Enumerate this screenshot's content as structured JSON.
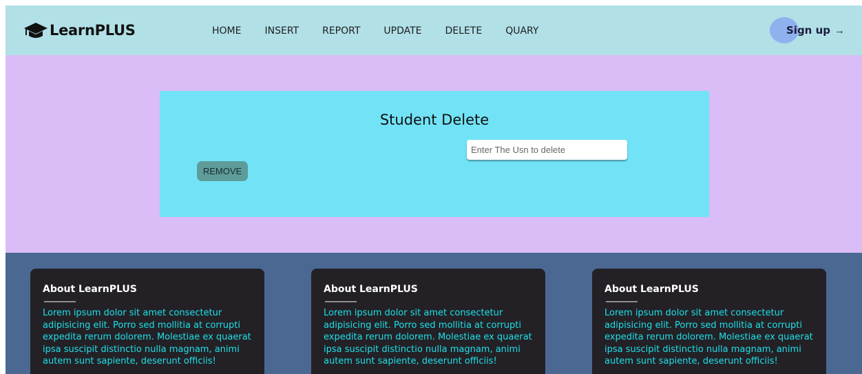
{
  "navbar": {
    "logo_icon": "graduation-cap-icon",
    "brand": "LearnPLUS",
    "links": [
      "HOME",
      "INSERT",
      "REPORT",
      "UPDATE",
      "DELETE",
      "QUARY"
    ],
    "signup_label": "Sign up",
    "signup_arrow": "→"
  },
  "main": {
    "title": "Student Delete",
    "usn_input": {
      "placeholder": "Enter The Usn to delete",
      "value": ""
    },
    "remove_label": "REMOVE"
  },
  "footer": {
    "cards": [
      {
        "title": "About LearnPLUS",
        "text": "Lorem ipsum dolor sit amet consectetur adipisicing elit. Porro sed mollitia at corrupti expedita rerum dolorem. Molestiae ex quaerat ipsa suscipit distinctio nulla magnam, animi autem sunt sapiente, deserunt officiis!"
      },
      {
        "title": "About LearnPLUS",
        "text": "Lorem ipsum dolor sit amet consectetur adipisicing elit. Porro sed mollitia at corrupti expedita rerum dolorem. Molestiae ex quaerat ipsa suscipit distinctio nulla magnam, animi autem sunt sapiente, deserunt officiis!"
      },
      {
        "title": "About LearnPLUS",
        "text": "Lorem ipsum dolor sit amet consectetur adipisicing elit. Porro sed mollitia at corrupti expedita rerum dolorem. Molestiae ex quaerat ipsa suscipit distinctio nulla magnam, animi autem sunt sapiente, deserunt officiis!"
      }
    ]
  },
  "colors": {
    "navbar_bg": "#b1e0e7",
    "main_bg": "#dabcf6",
    "card_bg": "#72e3f7",
    "footer_bg": "#4b6892",
    "footer_card_bg": "#232126",
    "footer_text": "#1ee0e8",
    "signup_accent": "#8fb1ee"
  }
}
